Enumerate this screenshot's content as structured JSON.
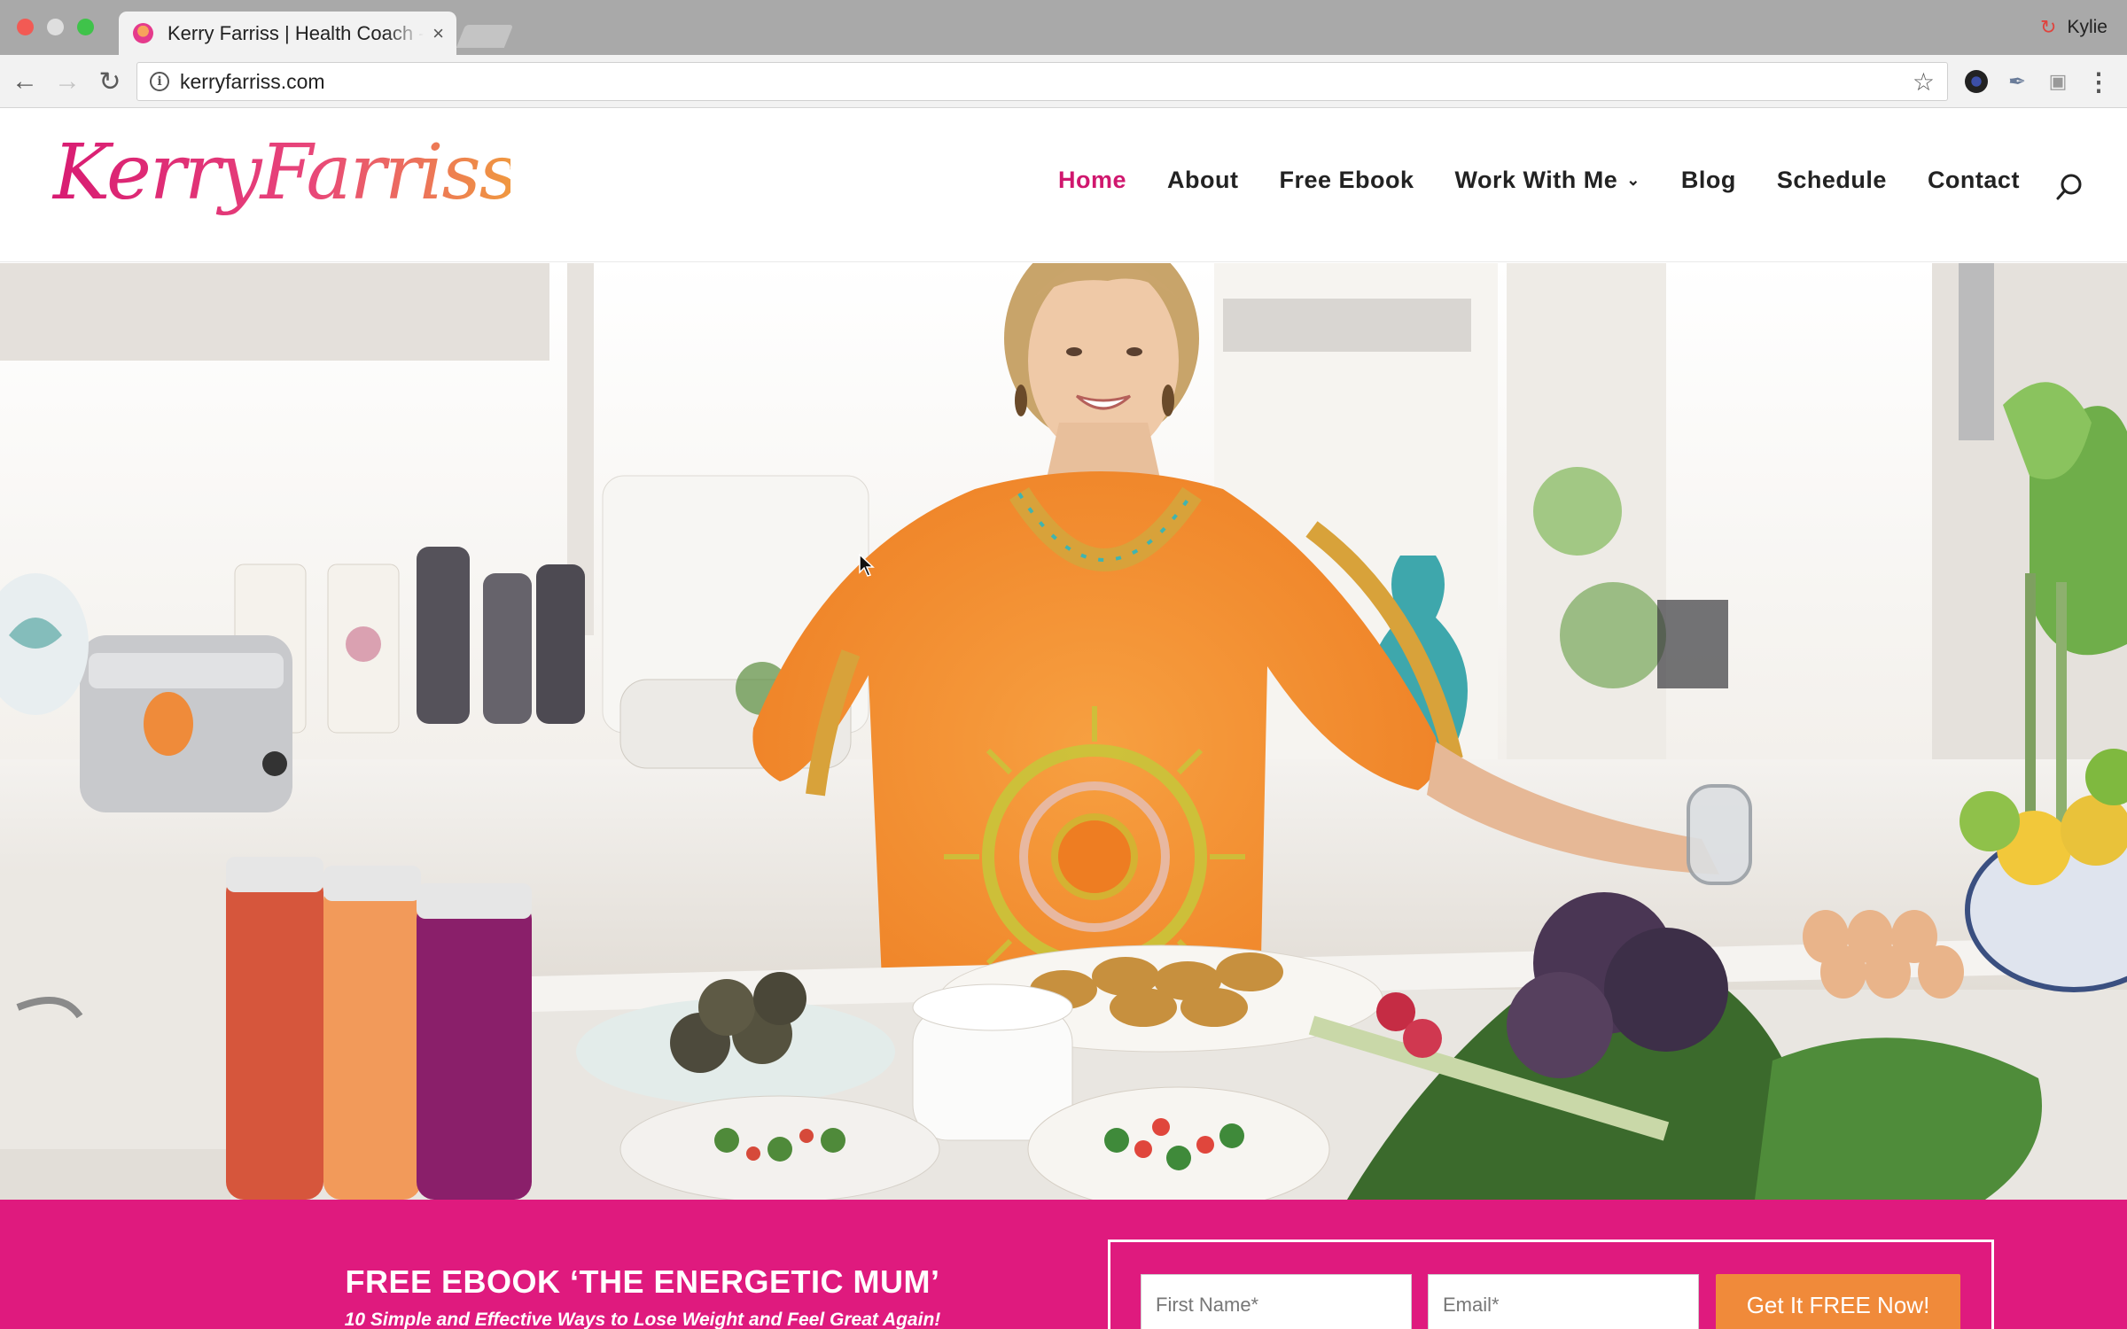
{
  "browser": {
    "tab_title": "Kerry Farriss | Health Coach - Kerry Farriss",
    "tab_close": "×",
    "profile_name": "Kylie",
    "url": "kerryfarriss.com",
    "icons": [
      "back-arrow-icon",
      "forward-arrow-icon",
      "reload-icon",
      "info-icon",
      "star-icon",
      "extension-icon",
      "eyedropper-icon",
      "camera-icon",
      "menu-icon"
    ]
  },
  "site": {
    "logo_text": "KerryFarriss",
    "nav": [
      {
        "label": "Home",
        "active": true
      },
      {
        "label": "About"
      },
      {
        "label": "Free Ebook"
      },
      {
        "label": "Work With Me",
        "has_dropdown": true
      },
      {
        "label": "Blog"
      },
      {
        "label": "Schedule"
      },
      {
        "label": "Contact"
      }
    ],
    "accent_color": "#d0176e"
  },
  "optin": {
    "title": "FREE EBOOK ‘THE ENERGETIC MUM’",
    "subtitle": "10 Simple and Effective Ways to Lose Weight and Feel Great Again!",
    "first_name_placeholder": "First Name*",
    "email_placeholder": "Email*",
    "button_label": "Get It FREE Now!",
    "band_color": "#df1a7e",
    "button_color": "#f08a3a"
  }
}
